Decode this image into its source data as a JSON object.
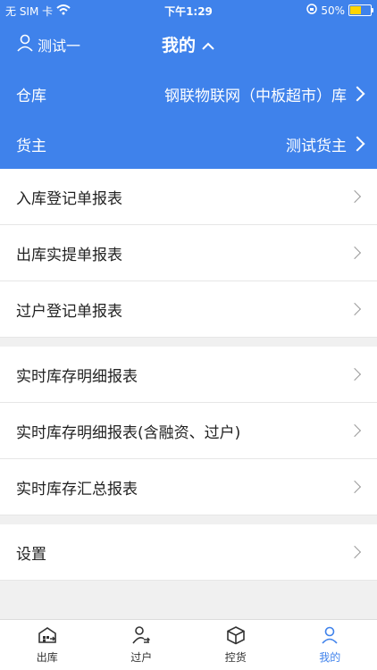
{
  "status": {
    "carrier": "无 SIM 卡",
    "time": "下午1:29",
    "battery": "50%"
  },
  "header": {
    "user": "测试一",
    "title": "我的"
  },
  "warehouse": {
    "label": "仓库",
    "value": "钢联物联网（中板超市）库"
  },
  "owner": {
    "label": "货主",
    "value": "测试货主"
  },
  "reports_group1": [
    "入库登记单报表",
    "出库实提单报表",
    "过户登记单报表"
  ],
  "reports_group2": [
    "实时库存明细报表",
    "实时库存明细报表(含融资、过户)",
    "实时库存汇总报表"
  ],
  "settings": {
    "label": "设置"
  },
  "tabs": [
    {
      "label": "出库",
      "icon": "warehouse-out-icon"
    },
    {
      "label": "过户",
      "icon": "transfer-user-icon"
    },
    {
      "label": "控货",
      "icon": "box-icon"
    },
    {
      "label": "我的",
      "icon": "profile-icon"
    }
  ],
  "colors": {
    "primary": "#3f82eb"
  }
}
